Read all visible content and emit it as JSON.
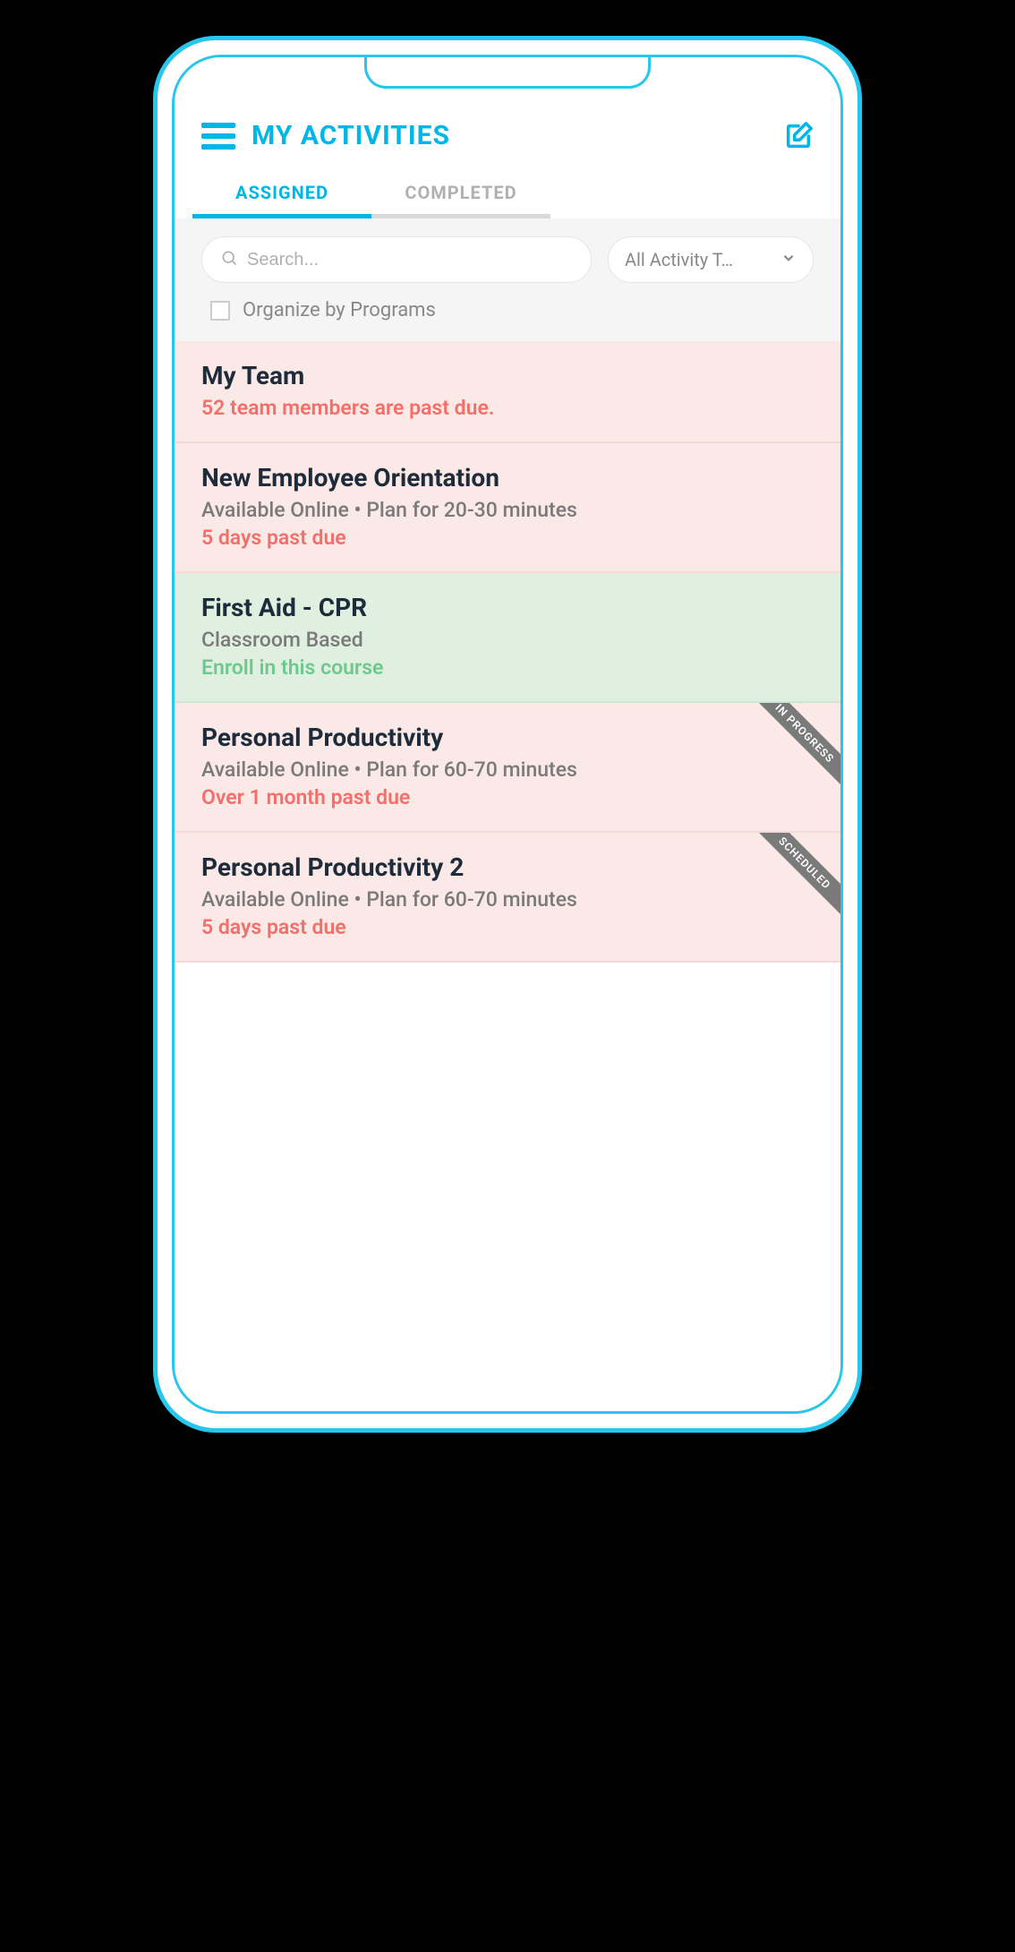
{
  "header": {
    "title": "MY ACTIVITIES"
  },
  "tabs": [
    {
      "label": "ASSIGNED",
      "active": true
    },
    {
      "label": "COMPLETED",
      "active": false
    }
  ],
  "search": {
    "placeholder": "Search..."
  },
  "filter_dropdown": {
    "selected": "All Activity T…"
  },
  "organize_checkbox": {
    "label": "Organize by Programs",
    "checked": false
  },
  "cards": [
    {
      "title": "My Team",
      "subtitle": "",
      "status": "52 team members are past due.",
      "status_color": "red",
      "bg": "pink",
      "ribbon": ""
    },
    {
      "title": "New Employee Orientation",
      "subtitle": "Available Online • Plan for 20-30 minutes",
      "status": "5 days past due",
      "status_color": "red",
      "bg": "pink",
      "ribbon": ""
    },
    {
      "title": "First Aid - CPR",
      "subtitle": "Classroom Based",
      "status": "Enroll in this course",
      "status_color": "green",
      "bg": "green",
      "ribbon": ""
    },
    {
      "title": "Personal Productivity",
      "subtitle": "Available Online • Plan for 60-70 minutes",
      "status": "Over 1 month past due",
      "status_color": "red",
      "bg": "pink",
      "ribbon": "IN PROGRESS"
    },
    {
      "title": "Personal Productivity 2",
      "subtitle": "Available Online • Plan for 60-70 minutes",
      "status": "5 days past due",
      "status_color": "red",
      "bg": "pink",
      "ribbon": "SCHEDULED"
    }
  ]
}
